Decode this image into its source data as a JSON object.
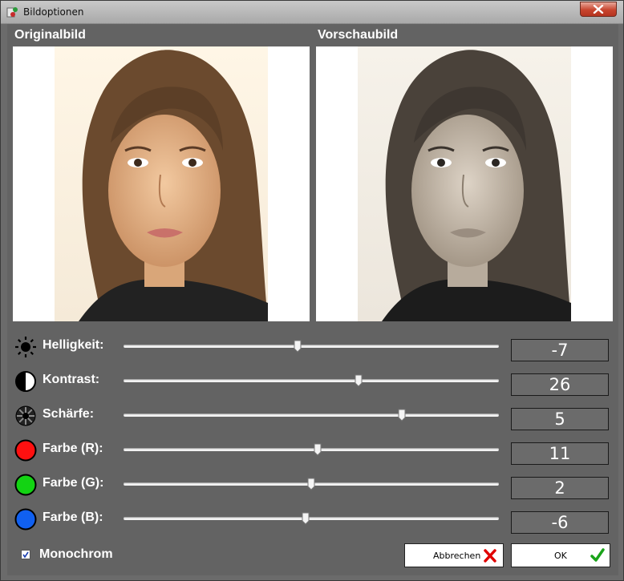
{
  "window": {
    "title": "Bildoptionen"
  },
  "panels": {
    "original_label": "Originalbild",
    "preview_label": "Vorschaubild"
  },
  "sliders": [
    {
      "label": "Helligkeit:",
      "value": "-7",
      "position": 0.463,
      "icon": "sun-icon"
    },
    {
      "label": "Kontrast:",
      "value": "26",
      "position": 0.627,
      "icon": "contrast-icon"
    },
    {
      "label": "Schärfe:",
      "value": "5",
      "position": 0.741,
      "icon": "sharpness-icon"
    },
    {
      "label": "Farbe (R):",
      "value": "11",
      "position": 0.518,
      "icon": "red-circle-icon",
      "color": "#ff1010"
    },
    {
      "label": "Farbe (G):",
      "value": "2",
      "position": 0.5,
      "icon": "green-circle-icon",
      "color": "#13d313"
    },
    {
      "label": "Farbe (B):",
      "value": "-6",
      "position": 0.485,
      "icon": "blue-circle-icon",
      "color": "#1060f0"
    }
  ],
  "monochrom": {
    "label": "Monochrom",
    "checked": true
  },
  "buttons": {
    "cancel": {
      "label": "Abbrechen",
      "icon": "red-x-icon"
    },
    "ok": {
      "label": "OK",
      "icon": "green-check-icon"
    }
  }
}
